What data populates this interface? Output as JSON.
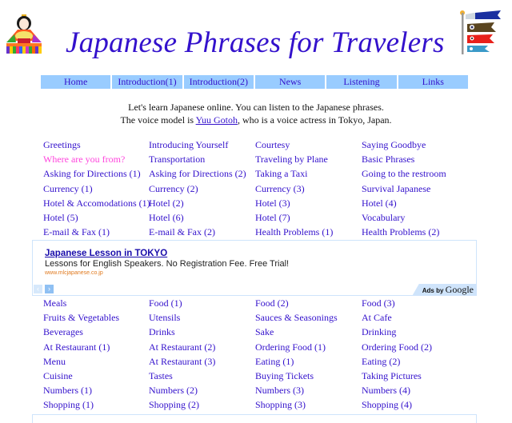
{
  "header": {
    "title": "Japanese Phrases for Travelers",
    "left_image": "hina-doll-icon",
    "right_image": "koinobori-carp-streamer-icon"
  },
  "nav": {
    "items": [
      {
        "label": "Home"
      },
      {
        "label": "Introduction(1)"
      },
      {
        "label": "Introduction(2)"
      },
      {
        "label": "News"
      },
      {
        "label": "Listening"
      },
      {
        "label": "Links"
      }
    ]
  },
  "intro": {
    "line1": "Let's learn Japanese online. You can listen to the Japanese phrases.",
    "line2_before": "The voice model is ",
    "line2_link": "Yuu Gotoh",
    "line2_after": ", who is a voice actress in Tokyo, Japan."
  },
  "topics_section1": [
    [
      "Greetings",
      "Introducing Yourself",
      "Courtesy",
      "Saying Goodbye"
    ],
    [
      "Where are you from?",
      "Transportation",
      "Traveling by Plane",
      "Basic Phrases"
    ],
    [
      "Asking for Directions (1)",
      "Asking for Directions (2)",
      "Taking a Taxi",
      "Going to the restroom"
    ],
    [
      "Currency (1)",
      "Currency (2)",
      "Currency (3)",
      "Survival Japanese"
    ],
    [
      "Hotel & Accomodations (1)",
      "Hotel (2)",
      "Hotel (3)",
      "Hotel (4)"
    ],
    [
      "Hotel (5)",
      "Hotel (6)",
      "Hotel (7)",
      "Vocabulary"
    ],
    [
      "E-mail & Fax (1)",
      "E-mail & Fax (2)",
      "Health Problems (1)",
      "Health Problems (2)"
    ]
  ],
  "visited_link": "Where are you from?",
  "ad": {
    "title": "Japanese Lesson in TOKYO",
    "description": "Lessons for English Speakers. No Registration Fee. Free Trial!",
    "url": "www.mlcjapanese.co.jp",
    "prev_icon": "‹",
    "next_icon": "›",
    "badge_ads": "Ads by ",
    "badge_google": "Google"
  },
  "topics_section2": [
    [
      "Meals",
      "Food (1)",
      "Food (2)",
      "Food (3)"
    ],
    [
      "Fruits & Vegetables",
      "Utensils",
      "Sauces & Seasonings",
      "At Cafe"
    ],
    [
      "Beverages",
      "Drinks",
      "Sake",
      "Drinking"
    ],
    [
      "At Restaurant (1)",
      "At Restaurant (2)",
      "Ordering Food (1)",
      "Ordering Food (2)"
    ],
    [
      "Menu",
      "At Restaurant (3)",
      "Eating (1)",
      "Eating (2)"
    ],
    [
      "Cuisine",
      "Tastes",
      "Buying Tickets",
      "Taking Pictures"
    ],
    [
      "Numbers (1)",
      "Numbers (2)",
      "Numbers (3)",
      "Numbers (4)"
    ],
    [
      "Shopping (1)",
      "Shopping (2)",
      "Shopping (3)",
      "Shopping (4)"
    ]
  ],
  "colors": {
    "link": "#3311cc",
    "visited": "#ff44dd",
    "nav_bg": "#99ccff",
    "ad_border": "#cfe4fb"
  }
}
